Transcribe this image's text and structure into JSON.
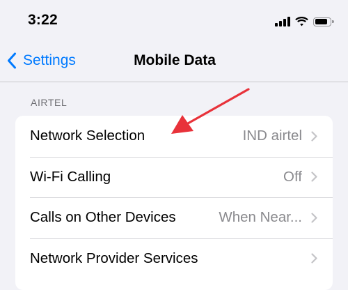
{
  "status_bar": {
    "time": "3:22"
  },
  "nav": {
    "back_label": "Settings",
    "title": "Mobile Data"
  },
  "section": {
    "header": "AIRTEL"
  },
  "rows": [
    {
      "label": "Network Selection",
      "value": "IND airtel"
    },
    {
      "label": "Wi-Fi Calling",
      "value": "Off"
    },
    {
      "label": "Calls on Other Devices",
      "value": "When Near..."
    },
    {
      "label": "Network Provider Services",
      "value": ""
    }
  ],
  "colors": {
    "accent": "#007aff",
    "annotation": "#e8323a",
    "background": "#f2f2f7",
    "secondary_text": "#8a8a8e"
  },
  "icons": {
    "back": "chevron-left-icon",
    "row": "chevron-right-icon",
    "annotation": "red-arrow-icon"
  }
}
